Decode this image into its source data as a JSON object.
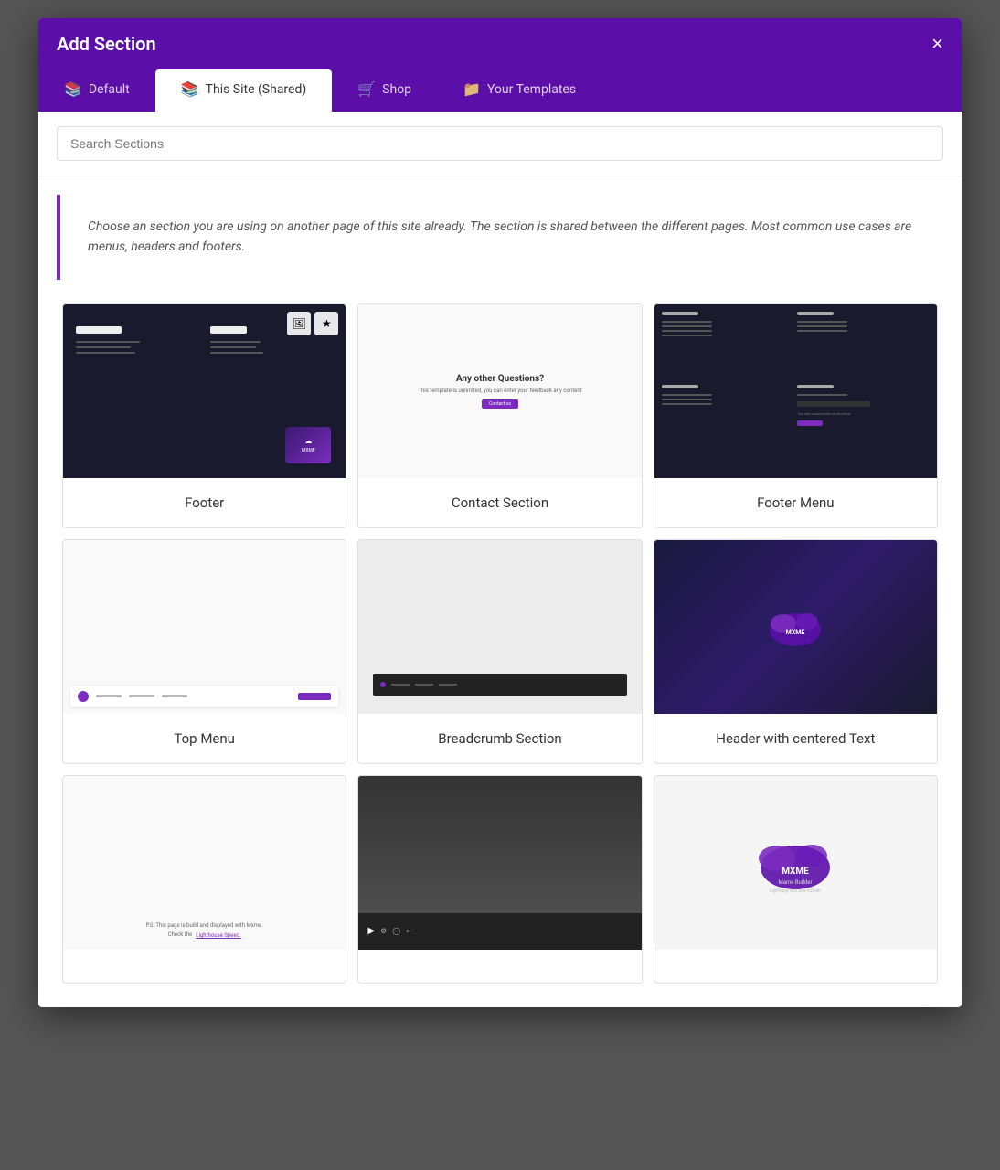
{
  "modal": {
    "title": "Add Section",
    "close_label": "×"
  },
  "tabs": [
    {
      "id": "default",
      "label": "Default",
      "icon": "📚",
      "active": false
    },
    {
      "id": "this-site",
      "label": "This Site (Shared)",
      "icon": "📚",
      "active": true
    },
    {
      "id": "shop",
      "label": "Shop",
      "icon": "🛒",
      "active": false
    },
    {
      "id": "your-templates",
      "label": "Your Templates",
      "icon": "📁",
      "active": false
    }
  ],
  "search": {
    "placeholder": "Search Sections"
  },
  "info_text": "Choose an section you are using on another page of this site already. The section is shared between the different pages. Most common use cases are menus, headers and footers.",
  "sections": [
    {
      "id": "footer",
      "label": "Footer",
      "preview_type": "footer_dark"
    },
    {
      "id": "contact",
      "label": "Contact Section",
      "preview_type": "contact"
    },
    {
      "id": "footer-menu",
      "label": "Footer Menu",
      "preview_type": "footer_menu"
    },
    {
      "id": "top-menu",
      "label": "Top Menu",
      "preview_type": "top_menu"
    },
    {
      "id": "breadcrumb",
      "label": "Breadcrumb Section",
      "preview_type": "breadcrumb"
    },
    {
      "id": "header-centered",
      "label": "Header with centered Text",
      "preview_type": "header_centered"
    },
    {
      "id": "footer-text",
      "label": "",
      "preview_type": "footer_text"
    },
    {
      "id": "video-section",
      "label": "",
      "preview_type": "video"
    },
    {
      "id": "logo-section",
      "label": "",
      "preview_type": "logo_only"
    }
  ]
}
